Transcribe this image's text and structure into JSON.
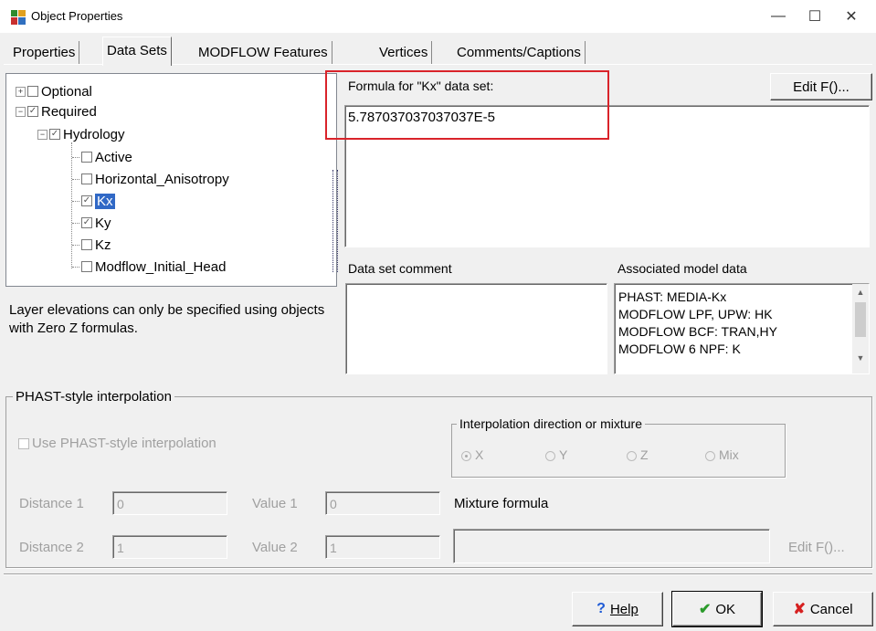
{
  "window": {
    "title": "Object Properties",
    "minimize": "—",
    "maximize": "☐",
    "close": "✕"
  },
  "tabs": [
    "Properties",
    "Data Sets",
    "MODFLOW Features",
    "Vertices",
    "Comments/Captions"
  ],
  "tree": {
    "optional": "Optional",
    "required": "Required",
    "hydrology": "Hydrology",
    "items": [
      "Active",
      "Horizontal_Anisotropy",
      "Kx",
      "Ky",
      "Kz",
      "Modflow_Initial_Head"
    ]
  },
  "info_text": "Layer elevations can only be specified using objects with Zero Z formulas.",
  "formula": {
    "label": "Formula for \"Kx\" data set:",
    "value": "5.787037037037037E-5",
    "edit_button": "Edit F()..."
  },
  "comment": {
    "label": "Data set comment",
    "value": ""
  },
  "associated": {
    "label": "Associated model data",
    "lines": [
      "PHAST: MEDIA-Kx",
      "MODFLOW LPF, UPW: HK",
      "MODFLOW BCF: TRAN,HY",
      "MODFLOW 6 NPF: K"
    ]
  },
  "phast": {
    "group_label": "PHAST-style interpolation",
    "use_label": "Use PHAST-style interpolation",
    "direction_label": "Interpolation direction or mixture",
    "directions": [
      "X",
      "Y",
      "Z",
      "Mix"
    ],
    "distance1_label": "Distance 1",
    "distance1_value": "0",
    "value1_label": "Value 1",
    "value1_value": "0",
    "distance2_label": "Distance 2",
    "distance2_value": "1",
    "value2_label": "Value 2",
    "value2_value": "1",
    "mixture_label": "Mixture formula",
    "mixture_value": "",
    "edit_button": "Edit F()..."
  },
  "buttons": {
    "help": "Help",
    "ok": "OK",
    "cancel": "Cancel"
  },
  "colors": {
    "highlight_box": "#d9232a",
    "selection": "#3169c6"
  }
}
